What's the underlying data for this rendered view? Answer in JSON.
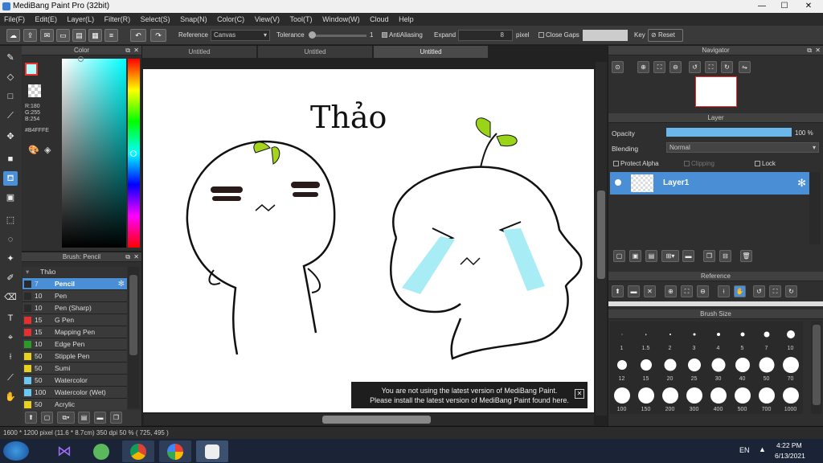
{
  "window": {
    "title": "MediBang Paint Pro (32bit)",
    "minimize": "—",
    "maximize": "☐",
    "close": "✕"
  },
  "menu": [
    "File(F)",
    "Edit(E)",
    "Layer(L)",
    "Filter(R)",
    "Select(S)",
    "Snap(N)",
    "Color(C)",
    "View(V)",
    "Tool(T)",
    "Window(W)",
    "Cloud",
    "Help"
  ],
  "toolbar": {
    "reference_label": "Reference",
    "reference_value": "Canvas",
    "tolerance_label": "Tolerance",
    "tolerance_value": "1",
    "antialiasing_label": "AntiAliasing",
    "expand_label": "Expand",
    "expand_value": "8",
    "expand_unit": "pixel",
    "close_gaps_label": "Close Gaps",
    "key_label": "Key",
    "reset_label": "Reset",
    "undo": "↶",
    "redo": "↷"
  },
  "color_panel": {
    "title": "Color",
    "r": "R:180",
    "g": "G:255",
    "b": "B:254",
    "hex": "#B4FFFE",
    "current_color": "#b4fffe"
  },
  "brush_panel": {
    "title": "Brush: Pencil",
    "group": "Thảo",
    "items": [
      {
        "size": "7",
        "name": "Pencil",
        "color": "#2a2a2a"
      },
      {
        "size": "10",
        "name": "Pen",
        "color": "#2a2a2a"
      },
      {
        "size": "10",
        "name": "Pen (Sharp)",
        "color": "#2a2a2a"
      },
      {
        "size": "15",
        "name": "G Pen",
        "color": "#e53030"
      },
      {
        "size": "15",
        "name": "Mapping Pen",
        "color": "#e53030"
      },
      {
        "size": "10",
        "name": "Edge Pen",
        "color": "#2a9a2a"
      },
      {
        "size": "50",
        "name": "Stipple Pen",
        "color": "#e8d020"
      },
      {
        "size": "50",
        "name": "Sumi",
        "color": "#e8d020"
      },
      {
        "size": "50",
        "name": "Watercolor",
        "color": "#6cc8f0"
      },
      {
        "size": "100",
        "name": "Watercolor (Wet)",
        "color": "#6cc8f0"
      },
      {
        "size": "50",
        "name": "Acrylic",
        "color": "#e8d020"
      }
    ]
  },
  "tabs": [
    "Untitled",
    "Untitled",
    "Untitled"
  ],
  "canvas": {
    "handwriting": "Thảo"
  },
  "notice": {
    "line1": "You are not using the latest version of MediBang Paint.",
    "line2": "Please install the latest version of MediBang Paint found here.",
    "close": "✕"
  },
  "navigator": {
    "title": "Navigator"
  },
  "layer_panel": {
    "title": "Layer",
    "opacity_label": "Opacity",
    "opacity_value": "100 %",
    "opacity_fraction": 1.0,
    "blending_label": "Blending",
    "blending_value": "Normal",
    "protect_alpha": "Protect Alpha",
    "clipping": "Clipping",
    "lock": "Lock",
    "layer_name": "Layer1"
  },
  "reference_panel": {
    "title": "Reference"
  },
  "brush_size_panel": {
    "title": "Brush Size",
    "sizes": [
      "1",
      "1.5",
      "2",
      "3",
      "4",
      "5",
      "7",
      "10",
      "12",
      "15",
      "20",
      "25",
      "30",
      "40",
      "50",
      "70",
      "100",
      "150",
      "200",
      "300",
      "400",
      "500",
      "700",
      "1000"
    ]
  },
  "status": {
    "text": "1600 * 1200 pixel   (11.6 * 8.7cm)   350 dpi   50 %   ( 725, 495 )"
  },
  "taskbar": {
    "lang": "EN",
    "time": "4:22 PM",
    "date": "6/13/2021"
  }
}
